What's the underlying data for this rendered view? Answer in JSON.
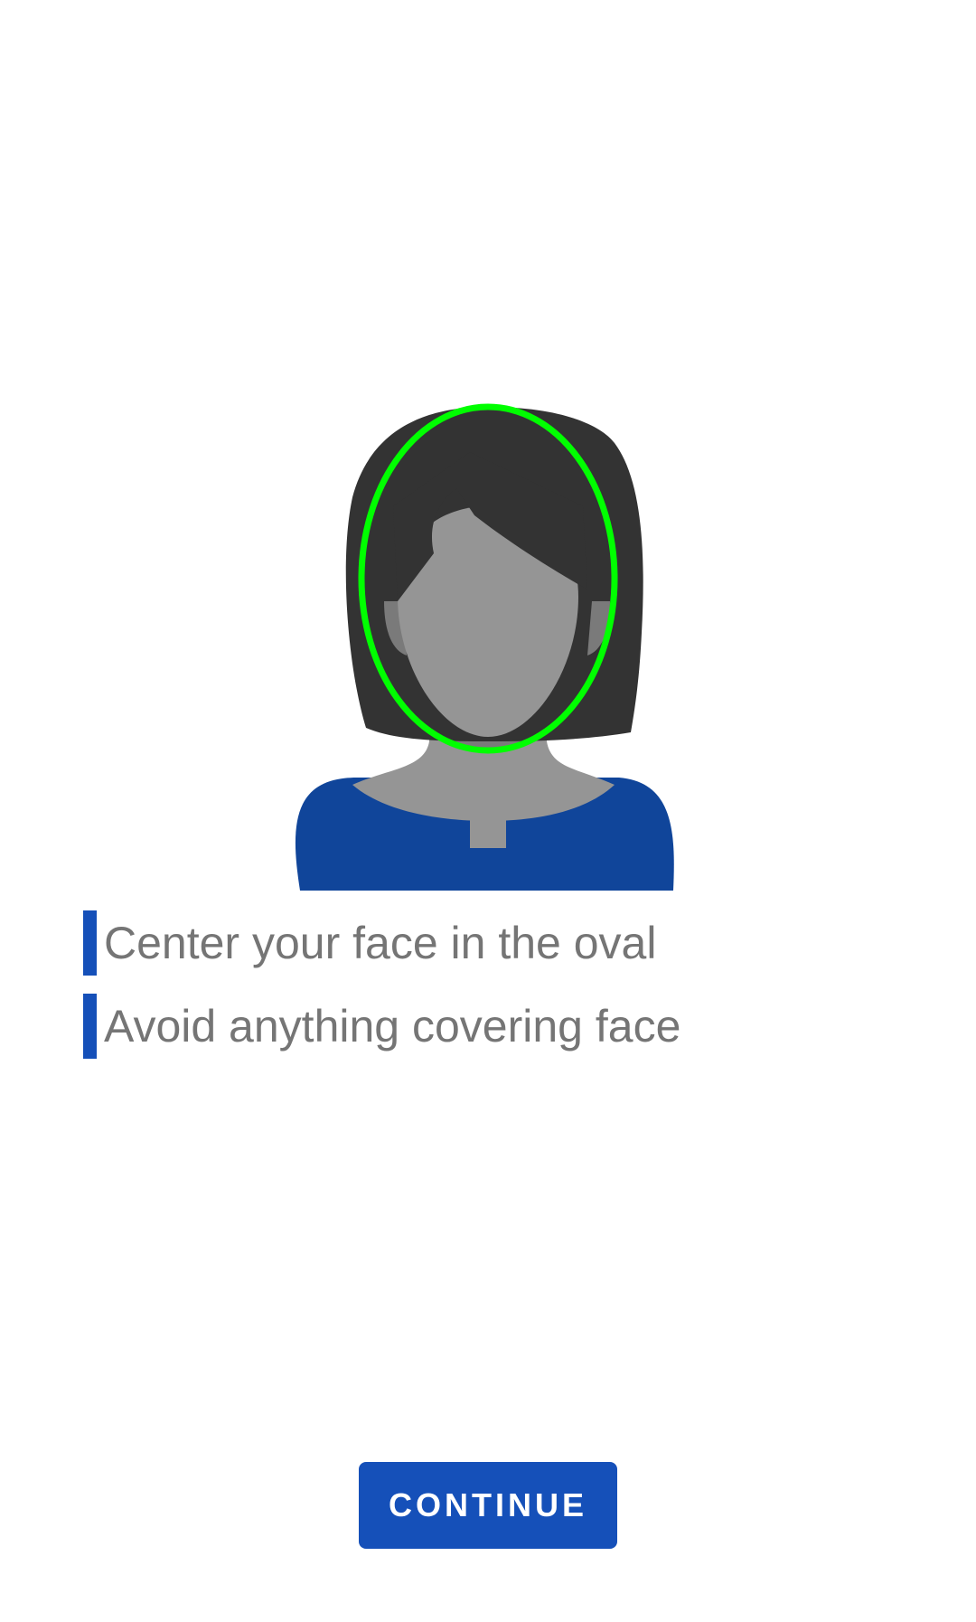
{
  "illustration": {
    "icon": "face-avatar-icon",
    "oval_icon": "face-guide-oval-icon",
    "colors": {
      "hair": "#333333",
      "skin": "#959595",
      "skin_shadow": "#7a7a7a",
      "shirt": "#10459a",
      "oval": "#00ff00"
    }
  },
  "instructions": [
    {
      "text": "Center your face in the oval"
    },
    {
      "text": "Avoid anything covering face"
    }
  ],
  "continue_button": {
    "label": "CONTINUE"
  },
  "colors": {
    "accent": "#1550b9",
    "text_secondary": "#757575",
    "background": "#ffffff"
  }
}
